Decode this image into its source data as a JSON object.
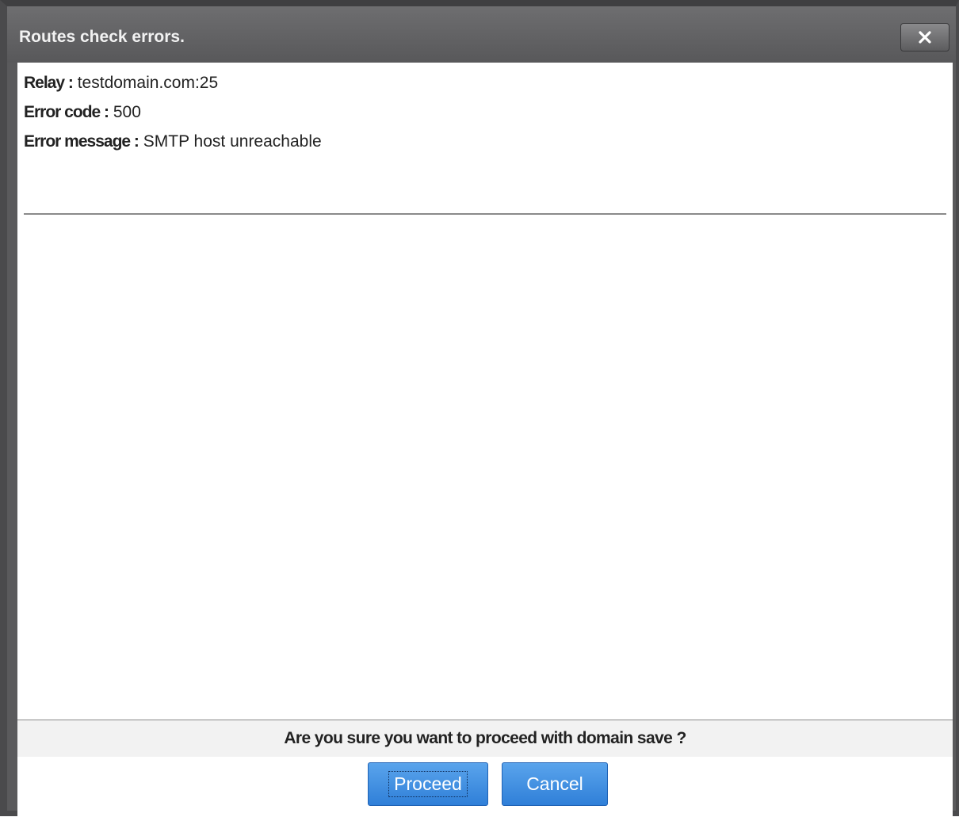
{
  "dialog": {
    "title": "Routes check errors.",
    "close_icon": "close-icon"
  },
  "details": {
    "relay_label": "Relay :",
    "relay_value": "testdomain.com:25",
    "error_code_label": "Error code :",
    "error_code_value": "500",
    "error_message_label": "Error message :",
    "error_message_value": "SMTP host unreachable"
  },
  "footer": {
    "question": "Are you sure you want to proceed with domain save ?",
    "proceed_label": "Proceed",
    "cancel_label": "Cancel"
  },
  "colors": {
    "titlebar": "#5a5a5c",
    "button_blue": "#3a8ae0"
  }
}
